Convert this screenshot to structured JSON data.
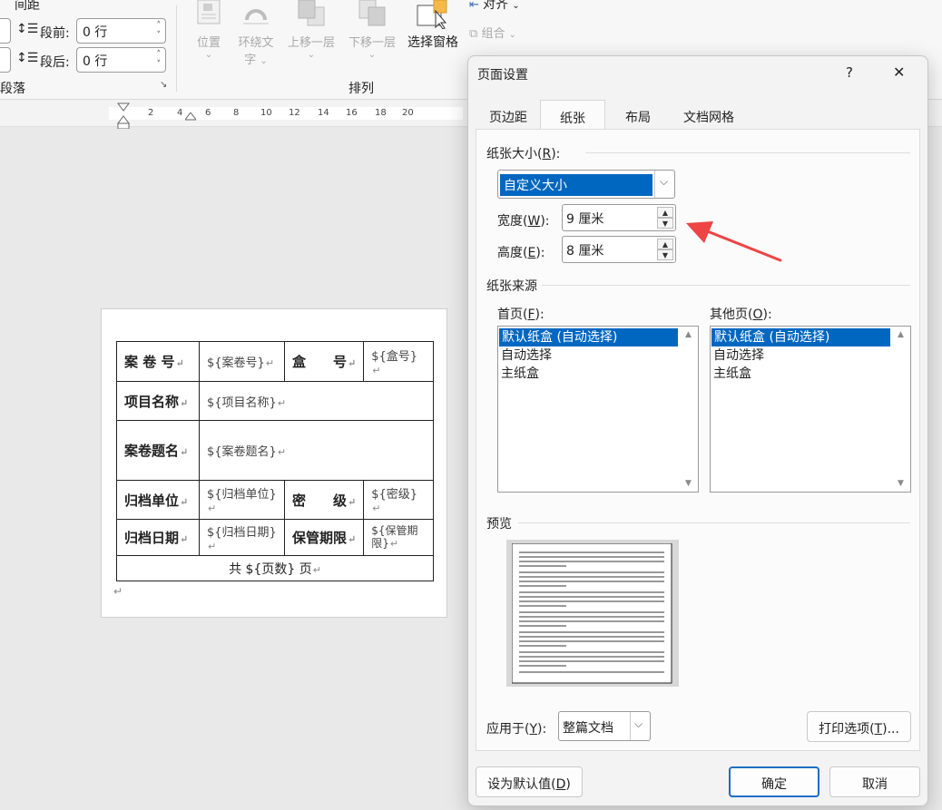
{
  "ribbon": {
    "spacing_label": "间距",
    "before_label": "段前:",
    "before_value": "0 行",
    "after_label": "段后:",
    "after_value": "0 行",
    "paragraph_group": "段落",
    "arrange_group": "排列",
    "position": "位置",
    "wrap_text_1": "环绕文",
    "wrap_text_2": "字",
    "bring_forward": "上移一层",
    "send_backward": "下移一层",
    "selection_pane": "选择窗格",
    "align": "对齐",
    "group": "组合"
  },
  "ruler": {
    "ticks": [
      "2",
      "4",
      "6",
      "8",
      "10",
      "12",
      "14",
      "16",
      "18",
      "20"
    ]
  },
  "document": {
    "rows": [
      [
        "案 卷 号",
        "${案卷号}",
        "盒　　号",
        "${盒号}"
      ],
      [
        "项目名称",
        "${项目名称}"
      ],
      [
        "案卷题名",
        "${案卷题名}"
      ],
      [
        "归档单位",
        "${归档单位}",
        "密　　级",
        "${密级}"
      ],
      [
        "归档日期",
        "${归档日期}",
        "保管期限",
        "${保管期限}"
      ],
      [
        "共 ${页数} 页"
      ]
    ],
    "return_mark": "↵"
  },
  "dialog": {
    "title": "页面设置",
    "help": "?",
    "close": "✕",
    "tabs": [
      "页边距",
      "纸张",
      "布局",
      "文档网格"
    ],
    "paper_size_label": "纸张大小(",
    "paper_size_key": "R",
    "paper_size_tail": "):",
    "paper_size_value": "自定义大小",
    "width_label": "宽度(",
    "width_key": "W",
    "width_tail": "):",
    "width_value": "9 厘米",
    "height_label": "高度(",
    "height_key": "E",
    "height_tail": "):",
    "height_value": "8 厘米",
    "source_label": "纸张来源",
    "first_page_label": "首页(",
    "first_page_key": "F",
    "first_page_tail": "):",
    "other_pages_label": "其他页(",
    "other_pages_key": "O",
    "other_pages_tail": "):",
    "first_page_options": [
      "默认纸盒 (自动选择)",
      "自动选择",
      "主纸盒"
    ],
    "other_pages_options": [
      "默认纸盒 (自动选择)",
      "自动选择",
      "主纸盒"
    ],
    "preview_label": "预览",
    "apply_label": "应用于(",
    "apply_key": "Y",
    "apply_tail": "):",
    "apply_value": "整篇文档",
    "print_options_label": "打印选项(",
    "print_options_key": "T",
    "print_options_tail": ")...",
    "set_default_label": "设为默认值(",
    "set_default_key": "D",
    "set_default_tail": ")",
    "ok": "确定",
    "cancel": "取消"
  },
  "colors": {
    "selection": "#0067c0",
    "annotation_arrow": "#ee4444"
  },
  "icons": [
    "spacing-before-icon",
    "spacing-after-icon",
    "position-icon",
    "wrap-text-icon",
    "bring-forward-icon",
    "send-backward-icon",
    "selection-pane-icon",
    "align-icon",
    "group-icon",
    "dropdown-arrow-icon",
    "annotation-arrow-icon"
  ]
}
